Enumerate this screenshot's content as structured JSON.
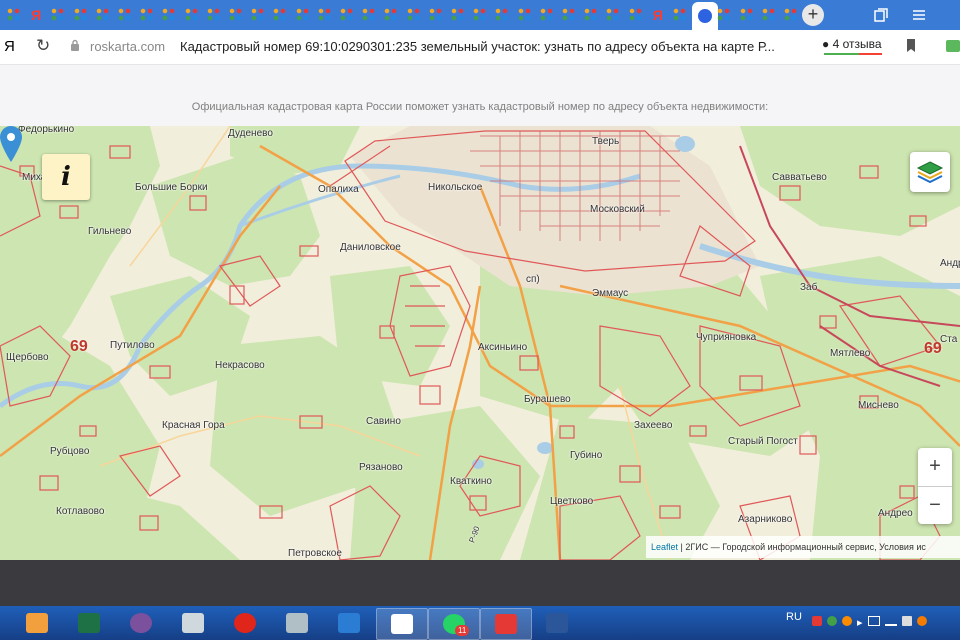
{
  "browser": {
    "tabs_count": 36,
    "active_tab_index": 31,
    "new_tab_icon": "plus-icon",
    "tab_controls": [
      "tabs-icon",
      "menu-icon"
    ],
    "address": {
      "brand": "Я",
      "domain": "roskarta.com",
      "title": "Кадастровый номер 69:10:0290301:235 земельный участок: узнать по адресу объекта на карте Р...",
      "reviews": "4 отзыва",
      "reviews_icon": "speech-bubble-icon"
    }
  },
  "page": {
    "tagline": "Официальная кадастровая карта России поможет узнать кадастровый номер по адресу объекта недвижимости:"
  },
  "map": {
    "info_label": "i",
    "zoom_in": "+",
    "zoom_out": "−",
    "attribution_link": "Leaflet",
    "attribution_text": " | 2ГИС — Городской информационный сервис, Условия ис",
    "road_number": "Р-90",
    "shields": [
      "69",
      "69"
    ],
    "places": [
      "Федорькино",
      "Дуденево",
      "Михалёво",
      "Большие Борки",
      "Опалиха",
      "Никольское",
      "Тверь",
      "Московский",
      "Савватьево",
      "Гильнево",
      "Даниловское",
      "Андрейково (Бурашевское",
      "сп)",
      "Эммаус",
      "Заб",
      "Щербово",
      "Путилово",
      "Некрасово",
      "Аксиньино",
      "Чуприяновка",
      "Мятлево",
      "Ста",
      "Бурашево",
      "Миснево",
      "Красная Гора",
      "Савино",
      "Захеево",
      "Рубцово",
      "Рязаново",
      "Кваткино",
      "Губино",
      "Старый Погост",
      "Котлавово",
      "Цветково",
      "Азарниково",
      "Андрео",
      "Петровское"
    ]
  },
  "taskbar": {
    "apps": [
      "start-icon",
      "excel-icon",
      "viber-icon",
      "calculator-icon",
      "opera-icon",
      "printer-icon",
      "edge-icon",
      "yandex-browser-icon",
      "whatsapp-icon",
      "yandex-icon",
      "word-icon"
    ],
    "whatsapp_badge": "11",
    "language": "RU"
  }
}
